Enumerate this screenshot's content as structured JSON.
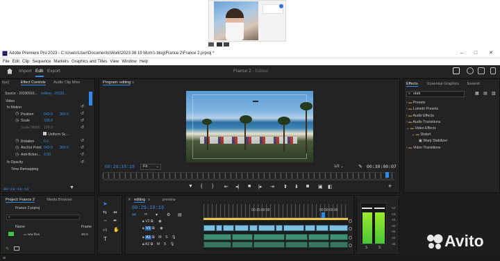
{
  "window": {
    "title": "Adobe Premiere Pro 2023 - C:\\Users\\User\\Documents\\Work\\2023 08 19 Mom's blog\\France 2\\France 2.prproj *",
    "controls": [
      "–",
      "□",
      "✕"
    ]
  },
  "menu": [
    "File",
    "Edit",
    "Clip",
    "Sequence",
    "Markers",
    "Graphics and Titles",
    "View",
    "Window",
    "Help"
  ],
  "header": {
    "tabs": [
      "Import",
      "Edit",
      "Export"
    ],
    "active_tab": "Edit",
    "project_title": "France 2",
    "project_status": "- Edited"
  },
  "effect_controls": {
    "tabs": [
      "lips)",
      "Effect Controls",
      "Audio Clip Mixe"
    ],
    "source_label": "Source - 20230910...",
    "clip_label": "editing - 20230...",
    "section": "Video",
    "rows": [
      {
        "label": "fx  Motion",
        "value": ""
      },
      {
        "label": "Position",
        "value": "640.0",
        "value2": "360.0"
      },
      {
        "label": "Scale",
        "value": "100.0",
        "value2": ""
      },
      {
        "label": "Scale Width",
        "value": "100.0",
        "value2": ""
      },
      {
        "label": "Uniform Sc...",
        "value": "",
        "value2": ""
      },
      {
        "label": "Rotation",
        "value": "0.0",
        "value2": ""
      },
      {
        "label": "Anchor Point",
        "value": "640.0",
        "value2": "360.0"
      },
      {
        "label": "Anti-flicker...",
        "value": "0.00",
        "value2": ""
      },
      {
        "label": "fx  Opacity",
        "value": "",
        "value2": ""
      },
      {
        "label": "Time Remapping",
        "value": "",
        "value2": ""
      }
    ],
    "timecode": "00:29:10:16"
  },
  "program_monitor": {
    "title": "Program: editing",
    "timecode": "00:29:10:16",
    "fit": "Fit",
    "resolution": "1/2",
    "duration": "00:30:00:07"
  },
  "effects": {
    "tabs": [
      "Effects",
      "Essential Graphics",
      "Essenti"
    ],
    "search": "stab",
    "items": [
      {
        "label": "Presets",
        "depth": 0
      },
      {
        "label": "Lumetri Presets",
        "depth": 0
      },
      {
        "label": "Audio Effects",
        "depth": 0
      },
      {
        "label": "Audio Transitions",
        "depth": 0
      },
      {
        "label": "Video Effects",
        "depth": 0
      },
      {
        "label": "Distort",
        "depth": 1
      },
      {
        "label": "Warp Stabilizer",
        "depth": 2
      },
      {
        "label": "Video Transitions",
        "depth": 0
      }
    ]
  },
  "project": {
    "tabs": [
      "Project: France 2",
      "Media Browser"
    ],
    "file": "France 2.prproj",
    "col_name": "Name",
    "col_frame": "Frame",
    "item_name": "new files",
    "item_frame": "30.0i"
  },
  "timeline": {
    "tabs": [
      "editing",
      "preview"
    ],
    "timecode": "00:29:10:16",
    "ruler": [
      "00:15:00:00",
      "00:30:00:00"
    ],
    "tracks": [
      {
        "name": "V2",
        "type": "video"
      },
      {
        "name": "V1",
        "type": "video"
      },
      {
        "name": "A1",
        "type": "audio"
      },
      {
        "name": "A2",
        "type": "audio"
      }
    ],
    "track_buttons": [
      "M",
      "S"
    ]
  },
  "meters": {
    "scale": [
      "-12",
      "-18",
      "-24",
      "-30",
      "-36",
      "-42",
      "-48",
      "-54",
      "dB"
    ],
    "channels": [
      "S",
      "S"
    ],
    "levels": [
      0.78,
      0.78
    ]
  },
  "watermark": "Avito",
  "colors": {
    "accent": "#2d8ceb",
    "value_blue": "#3a8be8",
    "panel": "#232323",
    "video_clip": "#7dc0e0",
    "audio_clip": "#3f8f72"
  }
}
